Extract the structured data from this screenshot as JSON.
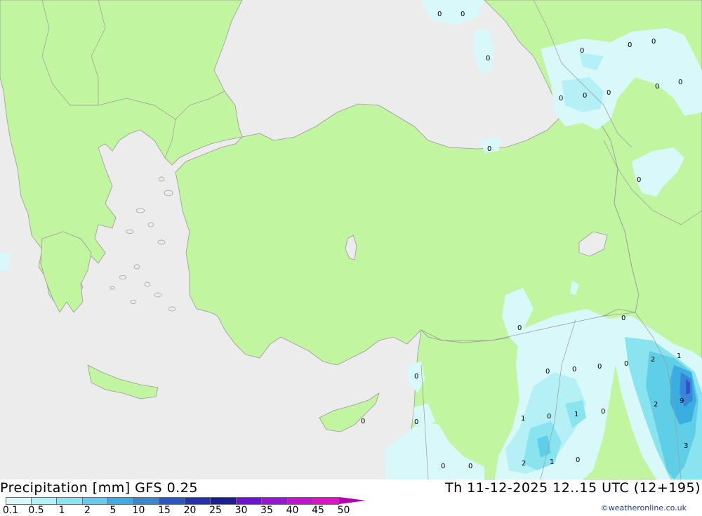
{
  "title": "Precipitation [mm] GFS 0.25",
  "valid_time": "Th 11-12-2025 12..15 UTC (12+195)",
  "credit": "©weatheronline.co.uk",
  "legend": {
    "labels": [
      "0.1",
      "0.5",
      "1",
      "2",
      "5",
      "10",
      "15",
      "20",
      "25",
      "30",
      "35",
      "40",
      "45",
      "50"
    ],
    "colors": [
      "#d8f8fa",
      "#b4f0f6",
      "#8ae4f0",
      "#5ecfe6",
      "#3aaee0",
      "#3b85d8",
      "#2f55cc",
      "#2530b4",
      "#1b1b9c",
      "#6a14d8",
      "#9c12d8",
      "#c810d8",
      "#e010d0",
      "#b000b0"
    ]
  },
  "colors": {
    "land": "#c2f5a0",
    "sea": "#ececec",
    "border": "#9a9a9a"
  },
  "map_labels": [
    "0",
    "0",
    "0",
    "0",
    "0",
    "0",
    "0",
    "0",
    "0",
    "0",
    "0",
    "0",
    "0",
    "0",
    "0",
    "0",
    "0",
    "0",
    "0",
    "0",
    "0",
    "0",
    "0",
    "0",
    "0",
    "0",
    "0",
    "1",
    "0",
    "1",
    "0",
    "2",
    "1",
    "0",
    "2",
    "1",
    "2",
    "9",
    "3"
  ]
}
